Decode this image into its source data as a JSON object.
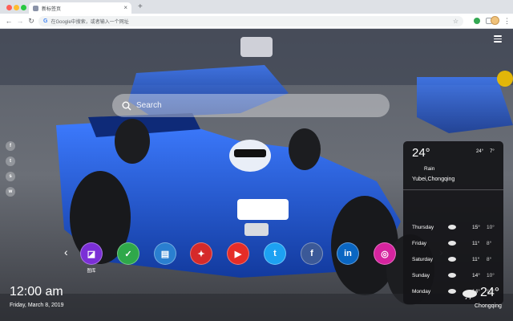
{
  "browser": {
    "tab_title": "新标签页",
    "tab_close": "×",
    "new_tab": "+",
    "omnibox_placeholder": "在Google中搜索，或者输入一个网址"
  },
  "search": {
    "placeholder": "Search"
  },
  "social_links": [
    {
      "icon": "facebook-icon",
      "glyph": "f"
    },
    {
      "icon": "twitter-icon",
      "glyph": "t"
    },
    {
      "icon": "share-icon",
      "glyph": "s"
    },
    {
      "icon": "wechat-icon",
      "glyph": "w"
    }
  ],
  "shortcuts": [
    {
      "icon": "gallery-icon",
      "label": "图库",
      "color": "#7b2fd6",
      "glyph": "◪"
    },
    {
      "icon": "check-icon",
      "label": "",
      "color": "#2fa84a",
      "glyph": "✓"
    },
    {
      "icon": "notes-icon",
      "label": "",
      "color": "#2a7fd0",
      "glyph": "▤"
    },
    {
      "icon": "game-icon",
      "label": "",
      "color": "#d52a2a",
      "glyph": "✦"
    },
    {
      "icon": "youtube-icon",
      "label": "",
      "color": "#e52d27",
      "glyph": "▶"
    },
    {
      "icon": "twitter-icon",
      "label": "",
      "color": "#1da1f2",
      "glyph": "t"
    },
    {
      "icon": "facebook-icon",
      "label": "",
      "color": "#3b5998",
      "glyph": "f"
    },
    {
      "icon": "linkedin-icon",
      "label": "",
      "color": "#0a66c2",
      "glyph": "in"
    },
    {
      "icon": "instagram-icon",
      "label": "",
      "color": "#d6249f",
      "glyph": "◎"
    }
  ],
  "weather_panel": {
    "temp": "24°",
    "high": "24°",
    "low": "7°",
    "condition": "Rain",
    "location": "Yubei,Chongqing",
    "forecast": [
      {
        "day": "Thursday",
        "high": "15°",
        "low": "10°"
      },
      {
        "day": "Friday",
        "high": "11°",
        "low": "8°"
      },
      {
        "day": "Saturday",
        "high": "11°",
        "low": "8°"
      },
      {
        "day": "Sunday",
        "high": "14°",
        "low": "10°"
      },
      {
        "day": "Monday",
        "high": "14°",
        "low": "10°"
      }
    ]
  },
  "clock": {
    "time": "12:00 am",
    "date": "Friday, March 8, 2019"
  },
  "weather_mini": {
    "temp": "24°",
    "city": "Chongqing"
  }
}
